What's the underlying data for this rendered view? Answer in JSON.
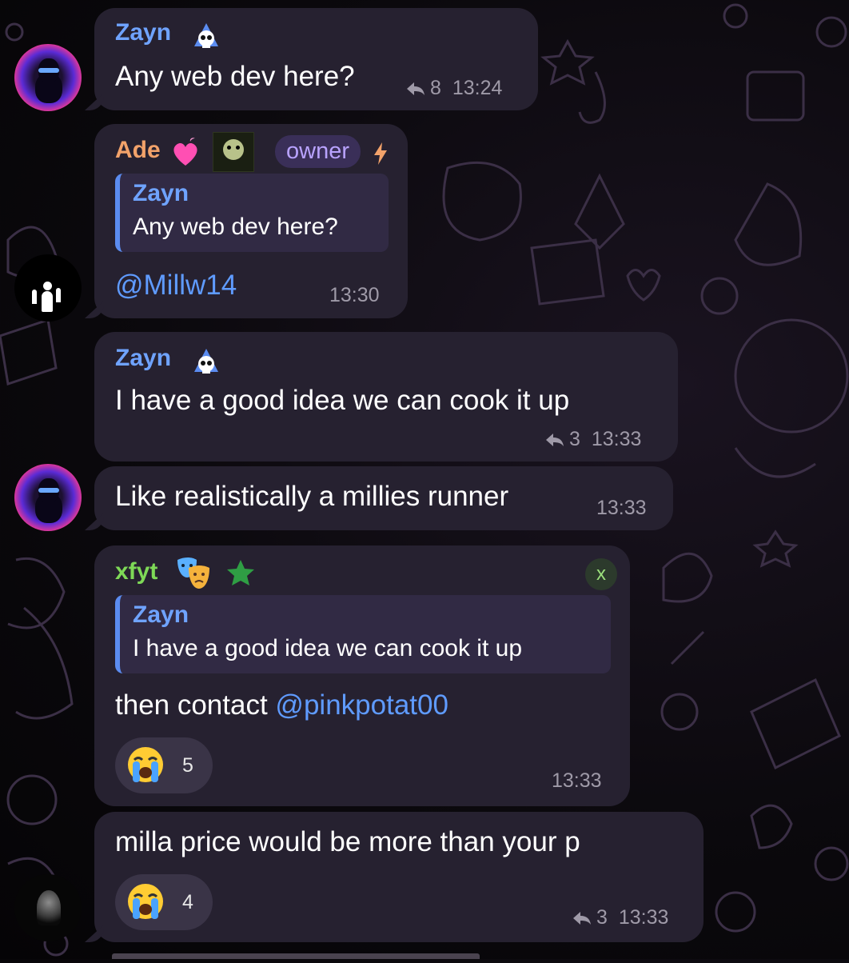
{
  "messages": [
    {
      "name": "Zayn",
      "text": "Any web dev here?",
      "replies": "8",
      "time": "13:24"
    },
    {
      "name": "Ade",
      "badge": "owner",
      "quote_name": "Zayn",
      "quote_text": "Any web dev here?",
      "text": "@Millw14",
      "time": "13:30"
    },
    {
      "name": "Zayn",
      "text": "I have a good idea we can cook it up",
      "replies": "3",
      "time": "13:33"
    },
    {
      "text": "Like realistically a millies runner",
      "time": "13:33"
    },
    {
      "name": "xfyt",
      "quote_name": "Zayn",
      "quote_text": "I have a good idea we can cook it up",
      "text_prefix": "then contact ",
      "mention": "@pinkpotat00",
      "reaction_count": "5",
      "close_label": "x",
      "time": "13:33"
    },
    {
      "text": "milla price would be more than  your p",
      "reaction_count": "4",
      "replies": "3",
      "time": "13:33"
    }
  ],
  "colors": {
    "bubble": "#262130",
    "zayn_name": "#6fa3ff",
    "ade_name": "#f2a26a",
    "xfyt_name": "#7ed957",
    "link": "#5f9bff",
    "meta": "#9f9aa8"
  },
  "icons": [
    "skull-icon",
    "heart-icon",
    "star-icon",
    "crying-face-icon",
    "reply-arrow-icon",
    "lightning-icon",
    "theatre-masks-icon"
  ]
}
